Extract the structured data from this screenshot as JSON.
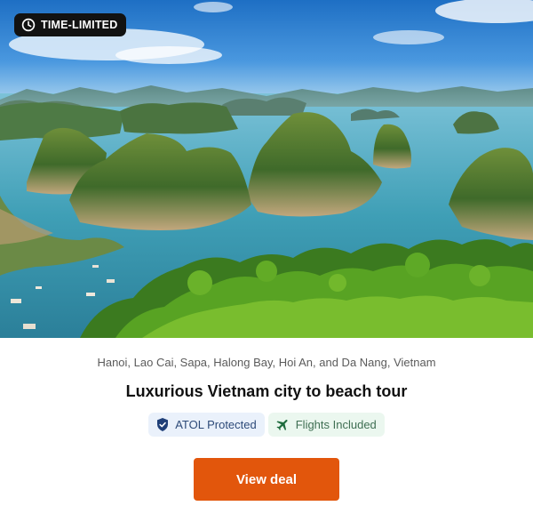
{
  "badge": {
    "label": "TIME-LIMITED",
    "icon": "clock-icon"
  },
  "hero": {
    "image": "halong-bay-photo"
  },
  "tour": {
    "location": "Hanoi, Lao Cai, Sapa, Halong Bay, Hoi An, and Da Nang, Vietnam",
    "title": "Luxurious Vietnam city to beach tour"
  },
  "tags": {
    "atol": {
      "label": "ATOL Protected",
      "icon": "shield-check-icon"
    },
    "flights": {
      "label": "Flights Included",
      "icon": "plane-icon"
    }
  },
  "cta": {
    "label": "View deal"
  },
  "colors": {
    "cta": "#e2560c",
    "badge_bg": "#121212",
    "atol_bg": "#eaf1fb",
    "flights_bg": "#ebf7ef"
  }
}
